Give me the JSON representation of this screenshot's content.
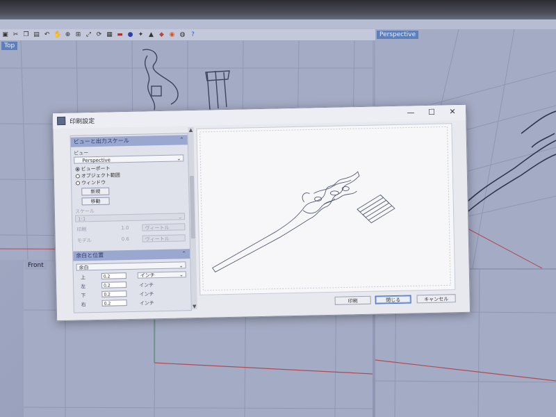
{
  "toolbar": {
    "icons": [
      "save-icon",
      "cut-icon",
      "copy-icon",
      "paste-icon",
      "undo-icon",
      "pan-hand-icon",
      "zoom-icon",
      "zoom-window-icon",
      "zoom-extents-icon",
      "rotate-view-icon",
      "grid-icon",
      "car-icon",
      "sphere-icon",
      "light-bulb-icon",
      "lock-icon",
      "material-icon",
      "color-wheel-icon",
      "render-icon",
      "help-icon"
    ]
  },
  "viewports": {
    "top": "Top",
    "perspective": "Perspective",
    "front": "Front"
  },
  "colors": {
    "viewport_accent": "#5f7fb9",
    "section_header": "#9aa8cf",
    "axis_red": "#b04a55",
    "axis_green": "#4a8e5f"
  },
  "dialog": {
    "title": "印刷設定",
    "window_controls": {
      "minimize": "—",
      "maximize": "☐",
      "close": "✕"
    },
    "section_view": {
      "header": "ビューと出力スケール",
      "collapse_glyph": "⌃",
      "view_label": "ビュー",
      "view_value": "Perspective",
      "radio_options": [
        "ビューポート",
        "オブジェクト範囲",
        "ウィンドウ"
      ],
      "selected_radio": 0,
      "new_button": "新規",
      "move_button": "移動",
      "scale_label": "スケール",
      "scale_value": "1:1",
      "scale_left_label": "印刷",
      "scale_left_value": "1.0",
      "scale_left_unit": "ヴィートル",
      "scale_right_label": "モデル",
      "scale_right_value": "0.6",
      "scale_right_unit": "ヴィートル"
    },
    "section_margins": {
      "header": "余白と位置",
      "collapse_glyph": "⌃",
      "mode": "余白",
      "rows": [
        {
          "label": "上",
          "value": "0.2",
          "unit": "インチ"
        },
        {
          "label": "左",
          "value": "0.2",
          "unit": "インチ"
        },
        {
          "label": "下",
          "value": "0.2",
          "unit": "インチ"
        },
        {
          "label": "右",
          "value": "0.2",
          "unit": "インチ"
        }
      ]
    },
    "buttons": {
      "print": "印刷",
      "close": "閉じる",
      "cancel": "キャンセル"
    }
  }
}
